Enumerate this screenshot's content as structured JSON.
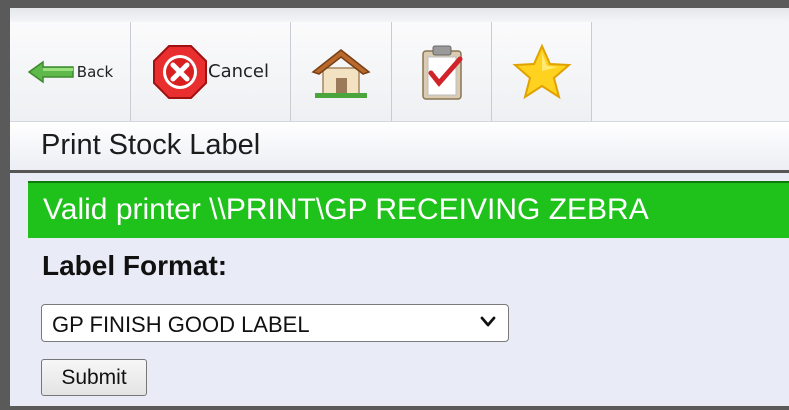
{
  "toolbar": {
    "back_label": "Back",
    "cancel_label": "Cancel",
    "buttons": [
      {
        "icon": "back-arrow-icon"
      },
      {
        "icon": "cancel-stop-icon"
      },
      {
        "icon": "home-icon"
      },
      {
        "icon": "clipboard-check-icon"
      },
      {
        "icon": "star-icon"
      }
    ]
  },
  "page": {
    "title": "Print Stock Label"
  },
  "status": {
    "message": "Valid printer \\\\PRINT\\GP RECEIVING ZEBRA",
    "color": "#1ec21a"
  },
  "form": {
    "label_format_label": "Label Format:",
    "label_format_value": "GP FINISH GOOD LABEL",
    "submit_label": "Submit"
  }
}
